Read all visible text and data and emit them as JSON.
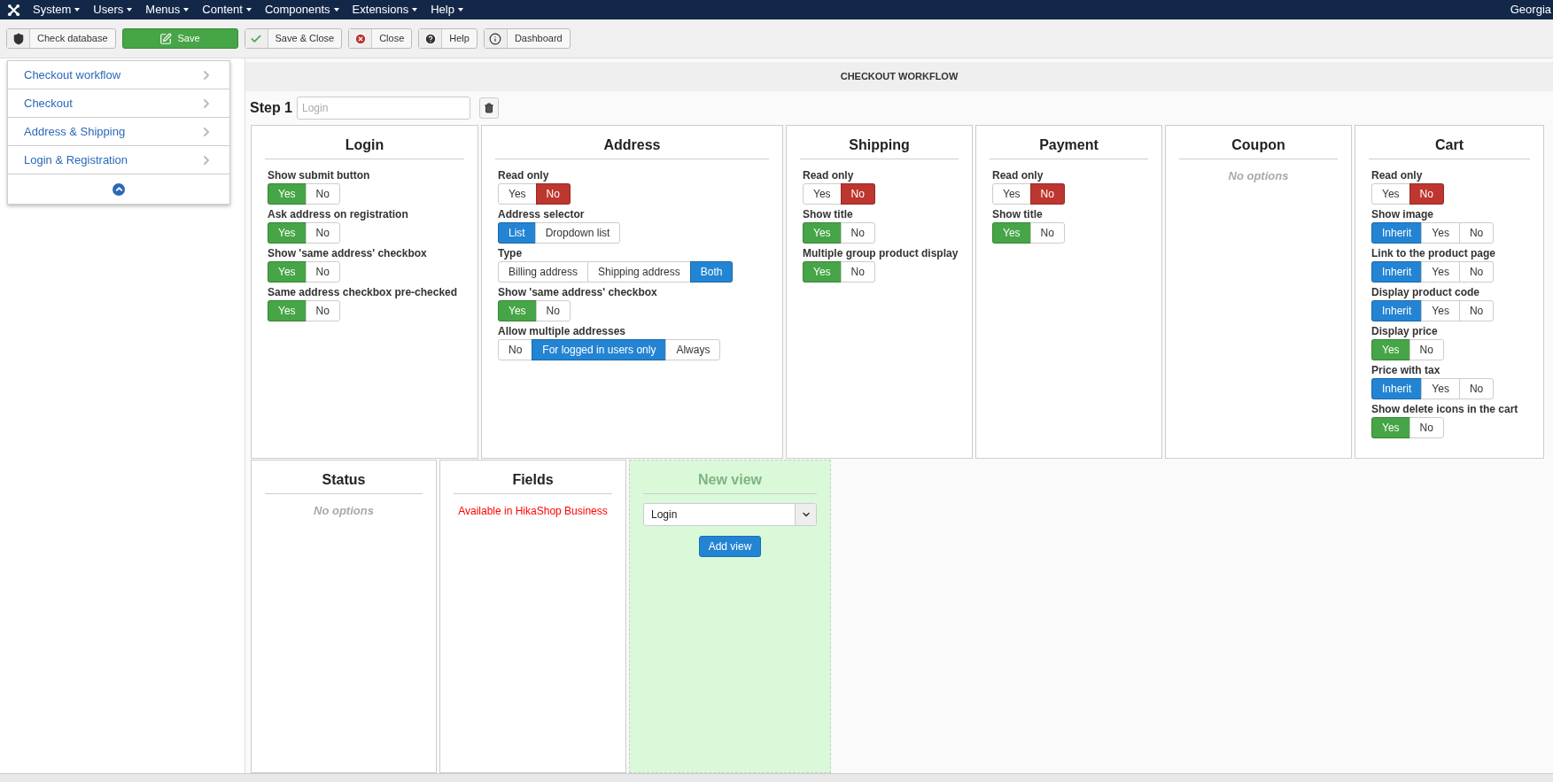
{
  "menu": {
    "items": [
      "System",
      "Users",
      "Menus",
      "Content",
      "Components",
      "Extensions",
      "Help"
    ],
    "user": "Georgia"
  },
  "toolbar": [
    {
      "label": "Check database",
      "kind": "shield"
    },
    {
      "label": "Save",
      "kind": "save"
    },
    {
      "label": "Save & Close",
      "kind": "check"
    },
    {
      "label": "Close",
      "kind": "close"
    },
    {
      "label": "Help",
      "kind": "help"
    },
    {
      "label": "Dashboard",
      "kind": "info"
    }
  ],
  "sidebar": {
    "items": [
      "Checkout workflow",
      "Checkout",
      "Address & Shipping",
      "Login & Registration"
    ]
  },
  "page_title": "CHECKOUT WORKFLOW",
  "step": {
    "label": "Step 1",
    "placeholder": "Login"
  },
  "rows": [
    [
      {
        "kind": "options",
        "title": "Login",
        "options": [
          {
            "label": "Show submit button",
            "choices": [
              {
                "label": "Yes",
                "selected": true,
                "color": "#46a546"
              },
              {
                "label": "No",
                "selected": false
              }
            ]
          },
          {
            "label": "Ask address on registration",
            "choices": [
              {
                "label": "Yes",
                "selected": true,
                "color": "#46a546"
              },
              {
                "label": "No",
                "selected": false
              }
            ]
          },
          {
            "label": "Show 'same address' checkbox",
            "choices": [
              {
                "label": "Yes",
                "selected": true,
                "color": "#46a546"
              },
              {
                "label": "No",
                "selected": false
              }
            ]
          },
          {
            "label": "Same address checkbox pre-checked",
            "choices": [
              {
                "label": "Yes",
                "selected": true,
                "color": "#46a546"
              },
              {
                "label": "No",
                "selected": false
              }
            ]
          }
        ]
      },
      {
        "kind": "options",
        "title": "Address",
        "options": [
          {
            "label": "Read only",
            "choices": [
              {
                "label": "Yes",
                "selected": false
              },
              {
                "label": "No",
                "selected": true,
                "color": "#bd362f"
              }
            ]
          },
          {
            "label": "Address selector",
            "choices": [
              {
                "label": "List",
                "selected": true,
                "color": "#2384d3"
              },
              {
                "label": "Dropdown list",
                "selected": false
              }
            ]
          },
          {
            "label": "Type",
            "choices": [
              {
                "label": "Billing address",
                "selected": false
              },
              {
                "label": "Shipping address",
                "selected": false
              },
              {
                "label": "Both",
                "selected": true,
                "color": "#2384d3"
              }
            ]
          },
          {
            "label": "Show 'same address' checkbox",
            "choices": [
              {
                "label": "Yes",
                "selected": true,
                "color": "#46a546"
              },
              {
                "label": "No",
                "selected": false
              }
            ]
          },
          {
            "label": "Allow multiple addresses",
            "choices": [
              {
                "label": "No",
                "selected": false
              },
              {
                "label": "For logged in users only",
                "selected": true,
                "color": "#2384d3"
              },
              {
                "label": "Always",
                "selected": false
              }
            ]
          }
        ]
      },
      {
        "kind": "options",
        "title": "Shipping",
        "options": [
          {
            "label": "Read only",
            "choices": [
              {
                "label": "Yes",
                "selected": false
              },
              {
                "label": "No",
                "selected": true,
                "color": "#bd362f"
              }
            ]
          },
          {
            "label": "Show title",
            "choices": [
              {
                "label": "Yes",
                "selected": true,
                "color": "#46a546"
              },
              {
                "label": "No",
                "selected": false
              }
            ]
          },
          {
            "label": "Multiple group product display",
            "choices": [
              {
                "label": "Yes",
                "selected": true,
                "color": "#46a546"
              },
              {
                "label": "No",
                "selected": false
              }
            ]
          }
        ]
      },
      {
        "kind": "options",
        "title": "Payment",
        "options": [
          {
            "label": "Read only",
            "choices": [
              {
                "label": "Yes",
                "selected": false
              },
              {
                "label": "No",
                "selected": true,
                "color": "#bd362f"
              }
            ]
          },
          {
            "label": "Show title",
            "choices": [
              {
                "label": "Yes",
                "selected": true,
                "color": "#46a546"
              },
              {
                "label": "No",
                "selected": false
              }
            ]
          }
        ]
      },
      {
        "kind": "empty",
        "title": "Coupon",
        "note": "No options"
      },
      {
        "kind": "options",
        "title": "Cart",
        "options": [
          {
            "label": "Read only",
            "choices": [
              {
                "label": "Yes",
                "selected": false
              },
              {
                "label": "No",
                "selected": true,
                "color": "#bd362f"
              }
            ]
          },
          {
            "label": "Show image",
            "choices": [
              {
                "label": "Inherit",
                "selected": true,
                "color": "#2384d3"
              },
              {
                "label": "Yes",
                "selected": false
              },
              {
                "label": "No",
                "selected": false
              }
            ]
          },
          {
            "label": "Link to the product page",
            "choices": [
              {
                "label": "Inherit",
                "selected": true,
                "color": "#2384d3"
              },
              {
                "label": "Yes",
                "selected": false
              },
              {
                "label": "No",
                "selected": false
              }
            ]
          },
          {
            "label": "Display product code",
            "choices": [
              {
                "label": "Inherit",
                "selected": true,
                "color": "#2384d3"
              },
              {
                "label": "Yes",
                "selected": false
              },
              {
                "label": "No",
                "selected": false
              }
            ]
          },
          {
            "label": "Display price",
            "choices": [
              {
                "label": "Yes",
                "selected": true,
                "color": "#46a546"
              },
              {
                "label": "No",
                "selected": false
              }
            ]
          },
          {
            "label": "Price with tax",
            "choices": [
              {
                "label": "Inherit",
                "selected": true,
                "color": "#2384d3"
              },
              {
                "label": "Yes",
                "selected": false
              },
              {
                "label": "No",
                "selected": false
              }
            ]
          },
          {
            "label": "Show delete icons in the cart",
            "choices": [
              {
                "label": "Yes",
                "selected": true,
                "color": "#46a546"
              },
              {
                "label": "No",
                "selected": false
              }
            ]
          }
        ]
      }
    ],
    [
      {
        "kind": "empty",
        "title": "Status",
        "note": "No options"
      },
      {
        "kind": "notice",
        "title": "Fields",
        "note": "Available in HikaShop Business"
      },
      {
        "kind": "new_view",
        "title": "New view",
        "value": "Login",
        "button": "Add view"
      }
    ]
  ]
}
